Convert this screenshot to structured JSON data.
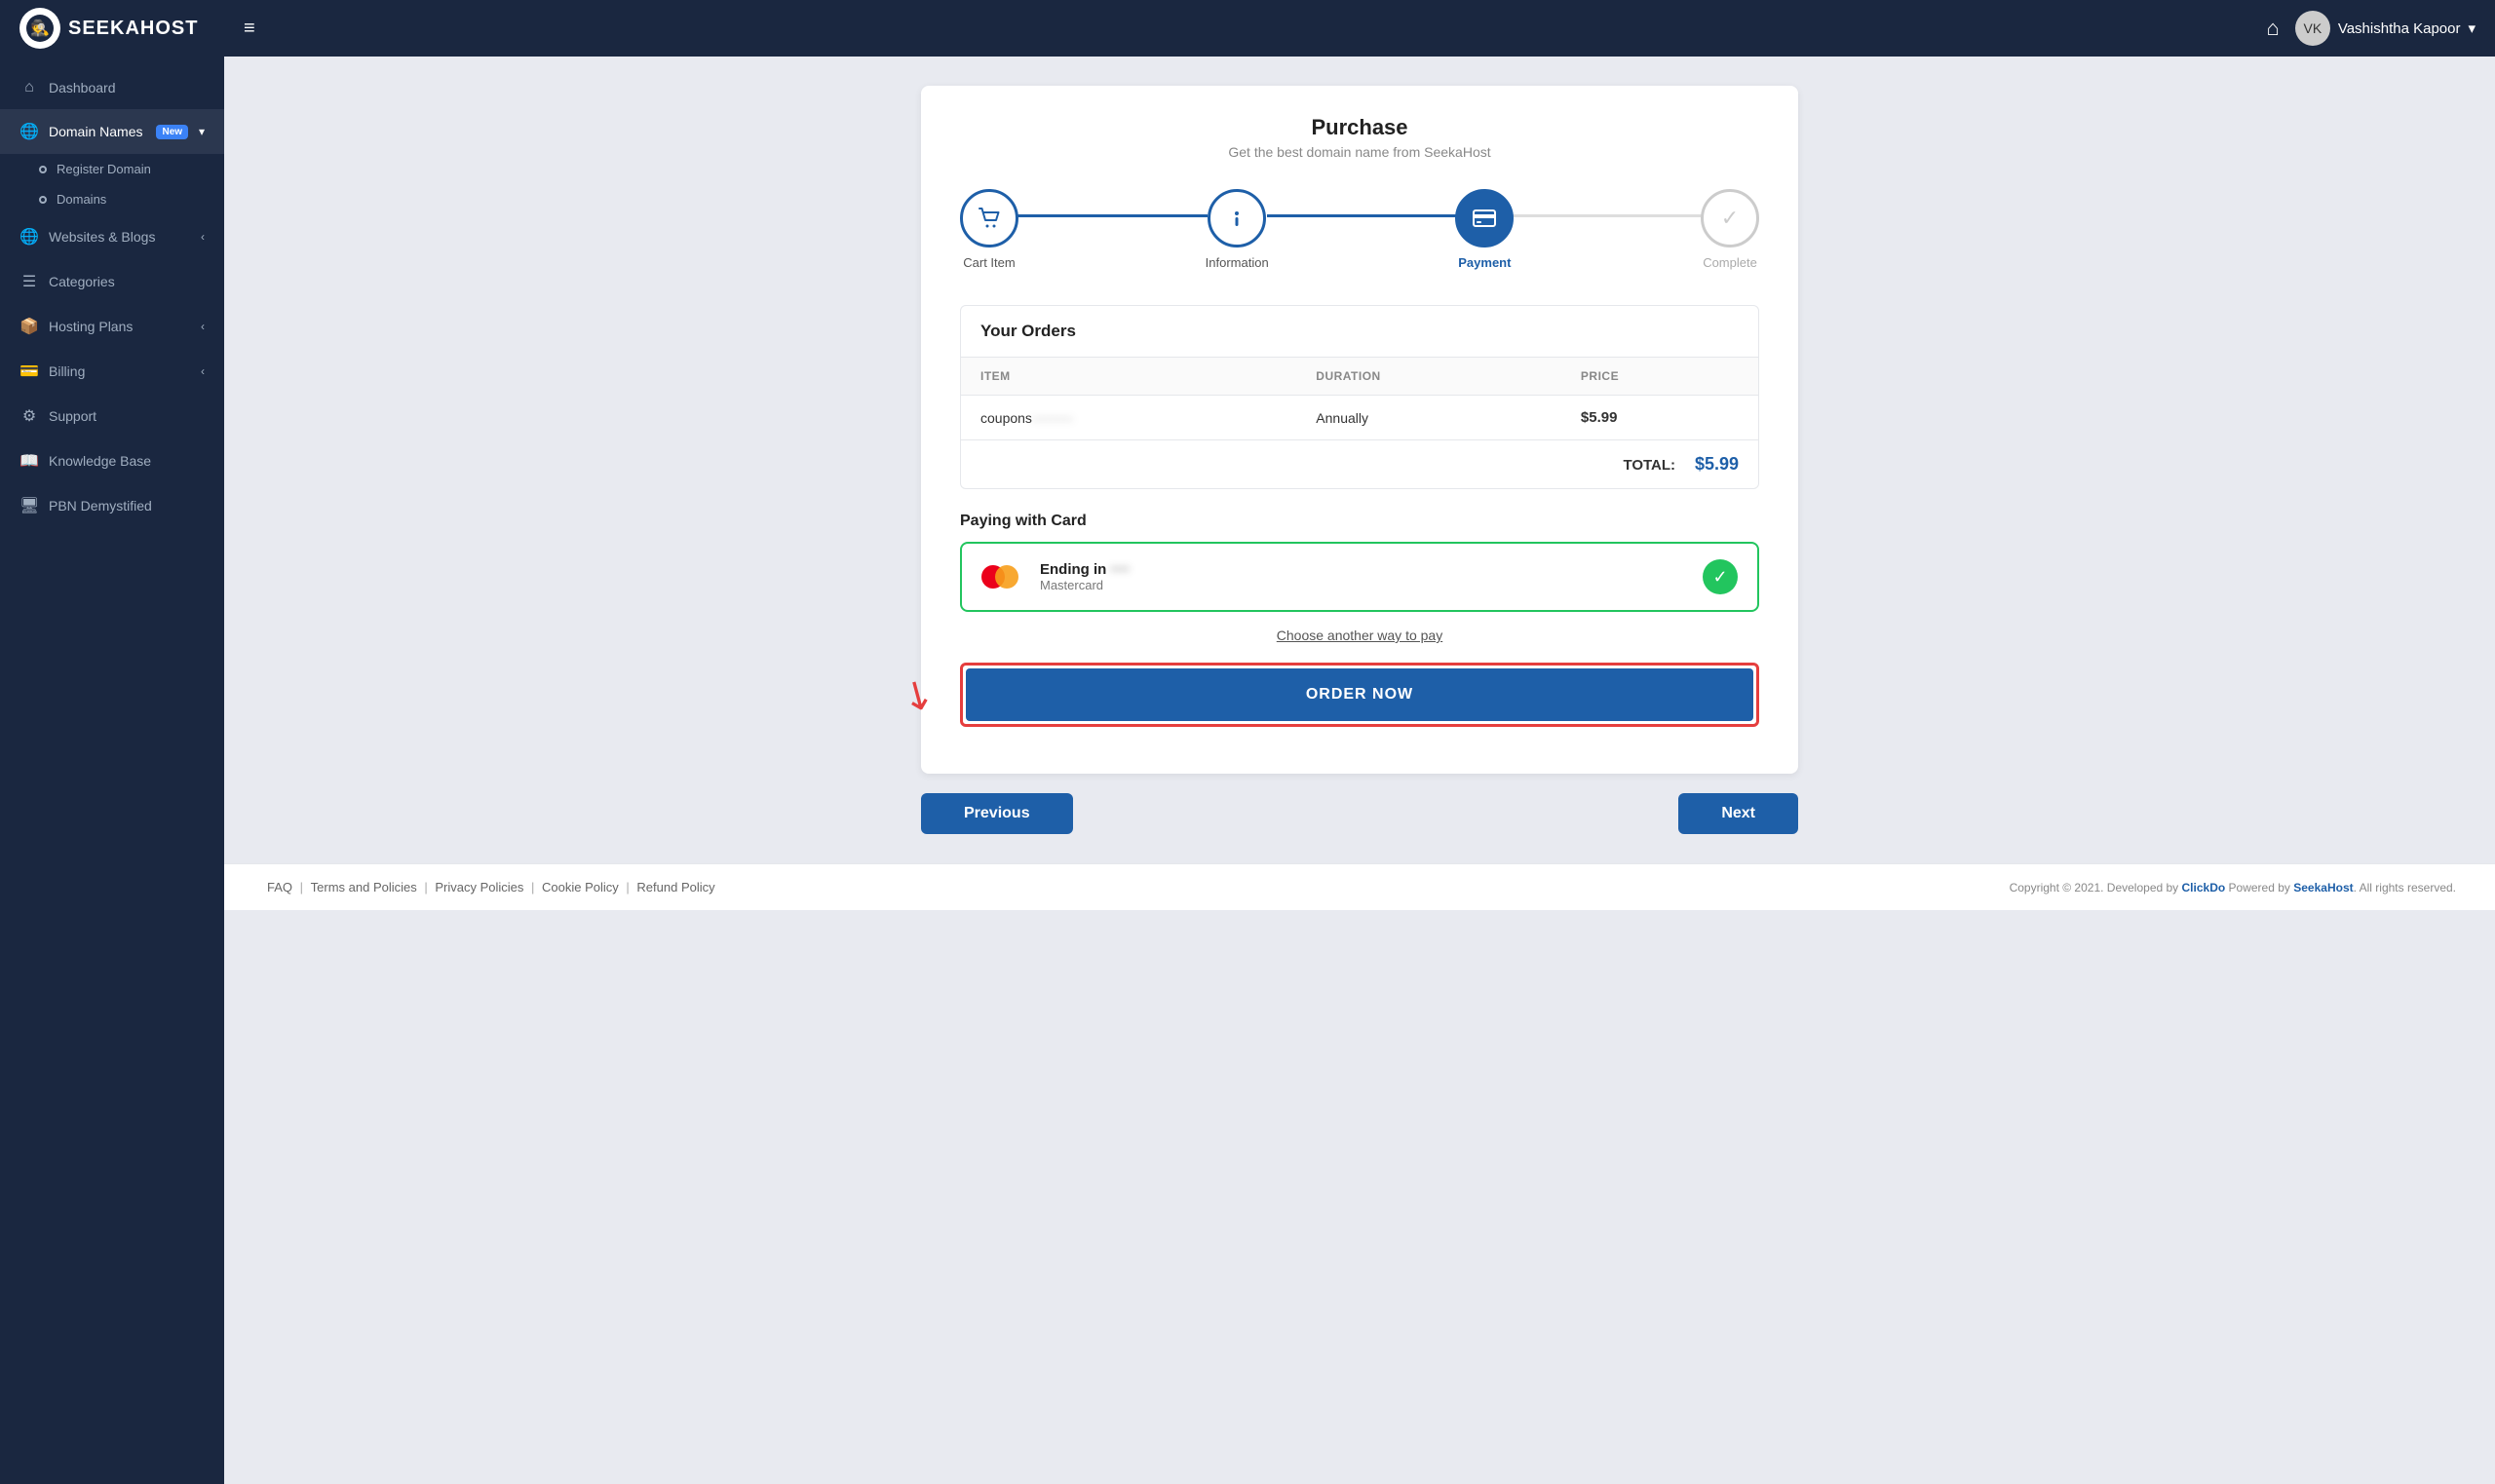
{
  "topbar": {
    "logo_text": "SEEKAHOST",
    "logo_tm": "™",
    "user_name": "Vashishtha Kapoor",
    "menu_icon": "≡",
    "home_icon": "⌂"
  },
  "sidebar": {
    "items": [
      {
        "id": "dashboard",
        "label": "Dashboard",
        "icon": "⌂",
        "active": false
      },
      {
        "id": "domain-names",
        "label": "Domain Names",
        "icon": "🌐",
        "badge": "New",
        "active": true,
        "expanded": true
      },
      {
        "id": "register-domain",
        "label": "Register Domain",
        "sub": true
      },
      {
        "id": "domains",
        "label": "Domains",
        "sub": true
      },
      {
        "id": "websites-blogs",
        "label": "Websites & Blogs",
        "icon": "🌐",
        "arrow": "‹",
        "active": false
      },
      {
        "id": "categories",
        "label": "Categories",
        "icon": "☰",
        "active": false
      },
      {
        "id": "hosting-plans",
        "label": "Hosting Plans",
        "icon": "📦",
        "arrow": "‹",
        "active": false
      },
      {
        "id": "billing",
        "label": "Billing",
        "icon": "💳",
        "arrow": "‹",
        "active": false
      },
      {
        "id": "support",
        "label": "Support",
        "icon": "⚙",
        "active": false
      },
      {
        "id": "knowledge-base",
        "label": "Knowledge Base",
        "icon": "📖",
        "active": false
      },
      {
        "id": "pbn-demystified",
        "label": "PBN Demystified",
        "icon": "🖥",
        "active": false
      }
    ]
  },
  "page": {
    "title": "Purchase",
    "subtitle": "Get the best domain name from SeekaHost"
  },
  "stepper": {
    "steps": [
      {
        "id": "cart",
        "label": "Cart Item",
        "icon": "🛒",
        "state": "done"
      },
      {
        "id": "info",
        "label": "Information",
        "icon": "ℹ",
        "state": "done"
      },
      {
        "id": "payment",
        "label": "Payment",
        "icon": "💳",
        "state": "active"
      },
      {
        "id": "complete",
        "label": "Complete",
        "icon": "✓",
        "state": "inactive"
      }
    ]
  },
  "orders": {
    "title": "Your Orders",
    "columns": [
      "ITEM",
      "DURATION",
      "PRICE"
    ],
    "rows": [
      {
        "item": "coupons",
        "item_blurred": "·····",
        "duration": "Annually",
        "price": "$5.99"
      }
    ],
    "total_label": "TOTAL:",
    "total_value": "$5.99"
  },
  "payment": {
    "section_label": "Paying with Card",
    "card": {
      "ending_label": "Ending in",
      "ending_value": "····",
      "card_type": "Mastercard"
    },
    "choose_another": "Choose another way to pay",
    "order_button": "ORDER NOW"
  },
  "navigation": {
    "previous": "Previous",
    "next": "Next"
  },
  "footer": {
    "links": [
      "FAQ",
      "Terms and Policies",
      "Privacy Policies",
      "Cookie Policy",
      "Refund Policy"
    ],
    "copyright": "Copyright © 2021. Developed by ClickDo Powered by SeekaHost. All rights reserved."
  }
}
